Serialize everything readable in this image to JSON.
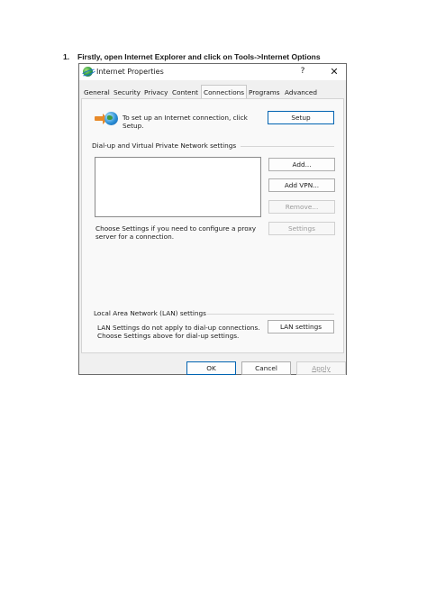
{
  "instruction": {
    "number": "1.",
    "text": "Firstly, open Internet Explorer and click on Tools->Internet Options"
  },
  "window": {
    "title": "Internet Properties",
    "help_label": "?",
    "close_label": "✕"
  },
  "tabs": [
    {
      "label": "General"
    },
    {
      "label": "Security"
    },
    {
      "label": "Privacy"
    },
    {
      "label": "Content"
    },
    {
      "label": "Connections",
      "active": true
    },
    {
      "label": "Programs"
    },
    {
      "label": "Advanced"
    }
  ],
  "setup_section": {
    "text_line1": "To set up an Internet connection, click",
    "text_line2": "Setup.",
    "setup_button": "Setup"
  },
  "dialup_section": {
    "heading": "Dial-up and Virtual Private Network settings",
    "add_button": "Add...",
    "add_vpn_button": "Add VPN...",
    "remove_button": "Remove...",
    "settings_button": "Settings",
    "proxy_text_line1": "Choose Settings if you need to configure a proxy",
    "proxy_text_line2": "server for a connection."
  },
  "lan_section": {
    "heading": "Local Area Network (LAN) settings",
    "text_line1": "LAN Settings do not apply to dial-up connections.",
    "text_line2": "Choose Settings above for dial-up settings.",
    "lan_button": "LAN settings"
  },
  "footer": {
    "ok": "OK",
    "cancel": "Cancel",
    "apply": "Apply"
  },
  "icons": {
    "app": "internet-explorer-icon",
    "connect": "connection-wizard-icon"
  }
}
